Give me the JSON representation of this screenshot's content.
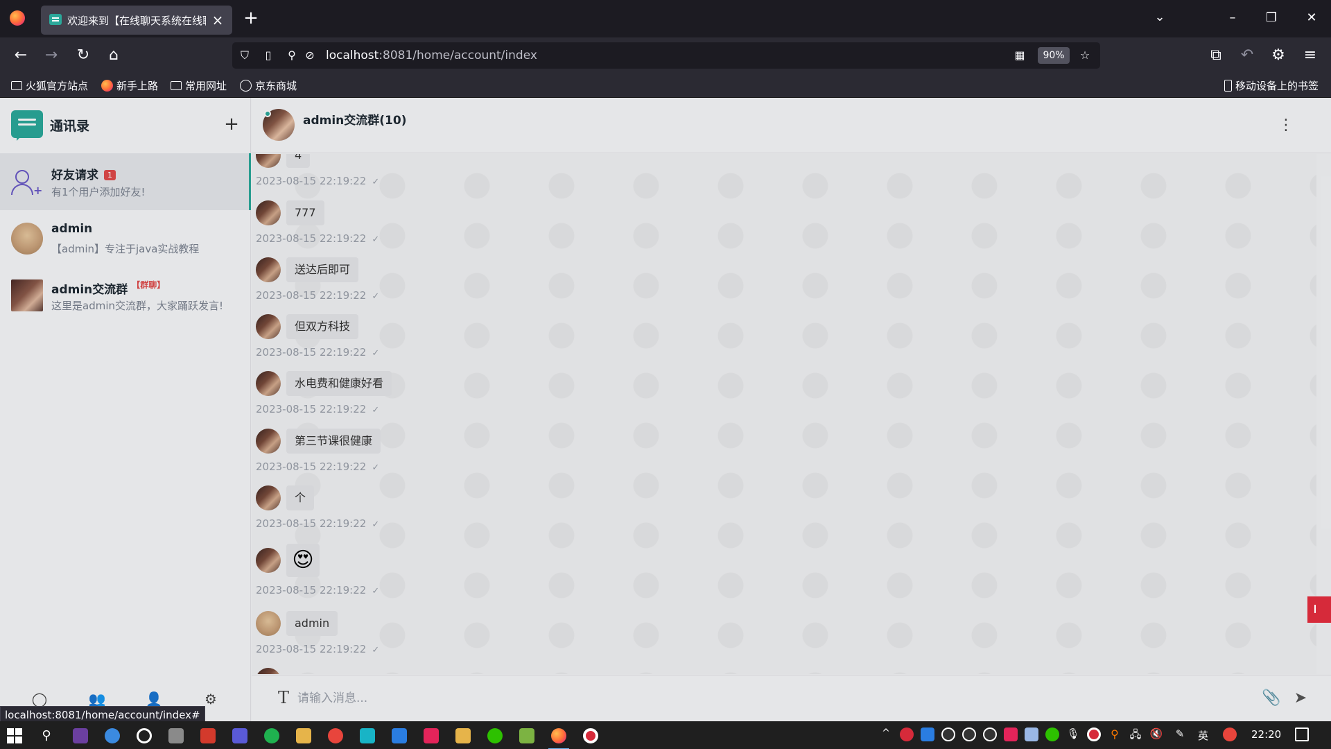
{
  "browser": {
    "tab_title": "欢迎来到【在线聊天系统在线聊",
    "url_host": "localhost",
    "url_rest": ":8081/home/account/index",
    "zoom": "90%",
    "status_url": "localhost:8081/home/account/index#",
    "bookmarks": [
      "火狐官方站点",
      "新手上路",
      "常用网址",
      "京东商城"
    ],
    "mobile_bookmarks": "移动设备上的书签"
  },
  "sidebar": {
    "title": "通讯录",
    "contacts": [
      {
        "name": "好友请求",
        "badge": "1",
        "message": "有1个用户添加好友!"
      },
      {
        "name": "admin",
        "message": "【admin】专注于java实战教程"
      },
      {
        "name": "admin交流群",
        "tag": "【群聊】",
        "message": "这里是admin交流群，大家踊跃发言!"
      }
    ]
  },
  "chat": {
    "title": "admin交流群(10)",
    "input_placeholder": "请输入消息...",
    "messages": [
      {
        "text": "4",
        "time": "2023-08-15 22:19:22"
      },
      {
        "text": "777",
        "time": "2023-08-15 22:19:22"
      },
      {
        "text": "送达后即可",
        "time": "2023-08-15 22:19:22"
      },
      {
        "text": "但双方科技",
        "time": "2023-08-15 22:19:22"
      },
      {
        "text": "水电费和健康好看",
        "time": "2023-08-15 22:19:22"
      },
      {
        "text": "第三节课很健康",
        "time": "2023-08-15 22:19:22"
      },
      {
        "text": "个",
        "time": "2023-08-15 22:19:22"
      },
      {
        "text": "😍",
        "time": "2023-08-15 22:19:22"
      },
      {
        "text": "admin",
        "time": "2023-08-15 22:19:22"
      }
    ]
  },
  "taskbar": {
    "ime": "英",
    "clock": "22:20"
  },
  "colors": {
    "accent": "#2ba89a",
    "badge": "#e04b4b",
    "browser_dark": "#1c1b22"
  }
}
